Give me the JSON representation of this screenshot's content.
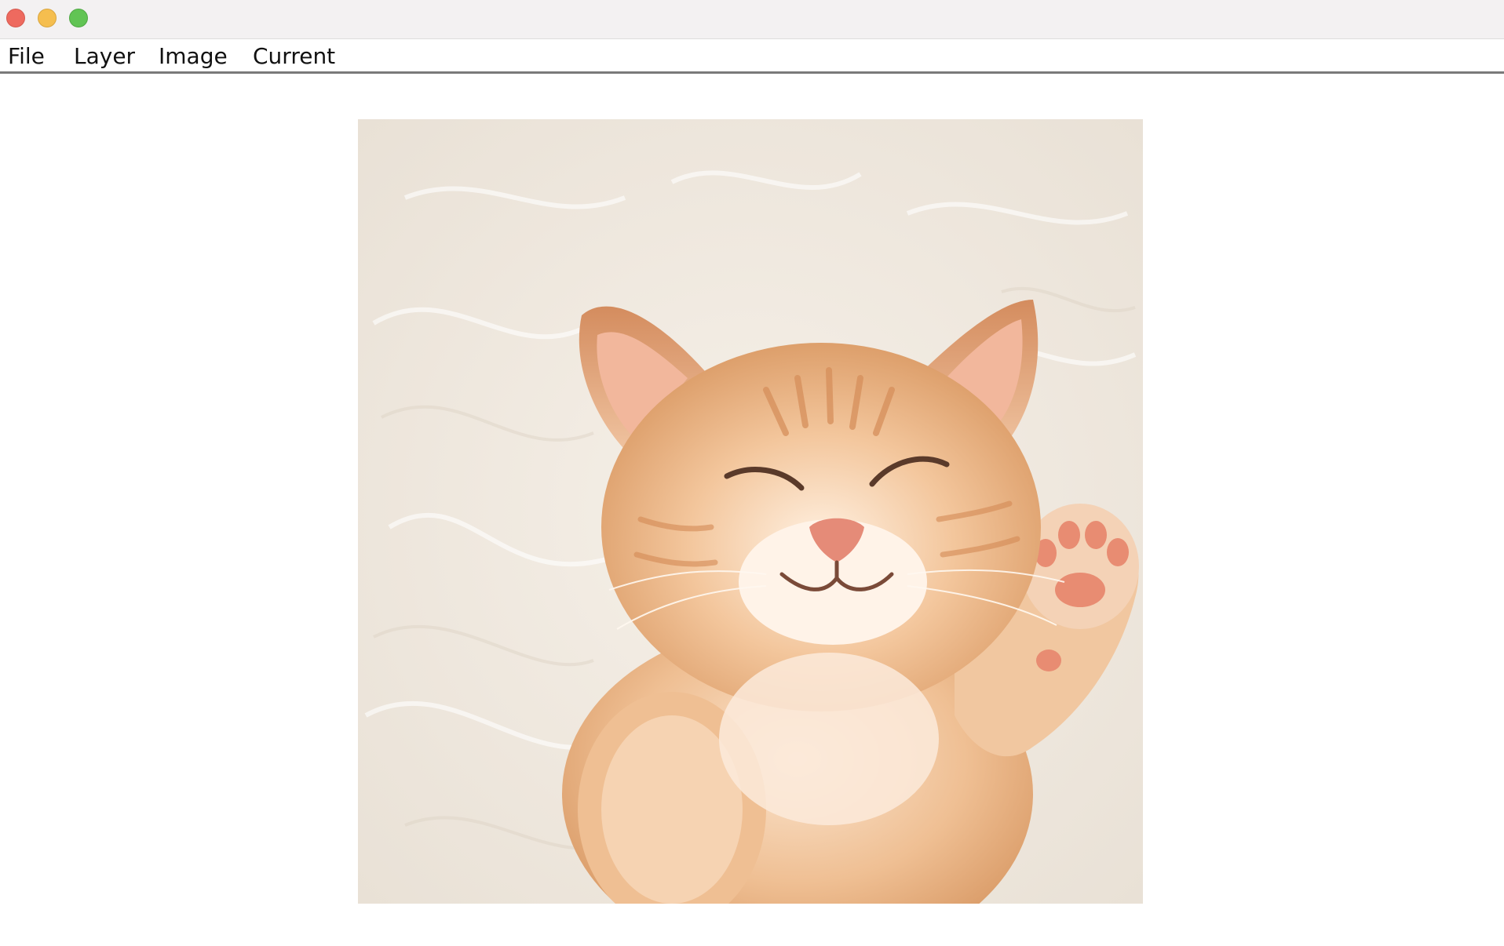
{
  "window": {
    "controls": {
      "close_color": "#ee6a5f",
      "minimize_color": "#f5be4f",
      "maximize_color": "#61c454"
    }
  },
  "menubar": {
    "items": [
      {
        "label": "File"
      },
      {
        "label": "Layer"
      },
      {
        "label": "Image"
      },
      {
        "label": "Current"
      }
    ]
  },
  "canvas": {
    "image_subject": "orange tabby kitten sleeping on white fur with one paw raised",
    "background_color": "#ffffff"
  }
}
